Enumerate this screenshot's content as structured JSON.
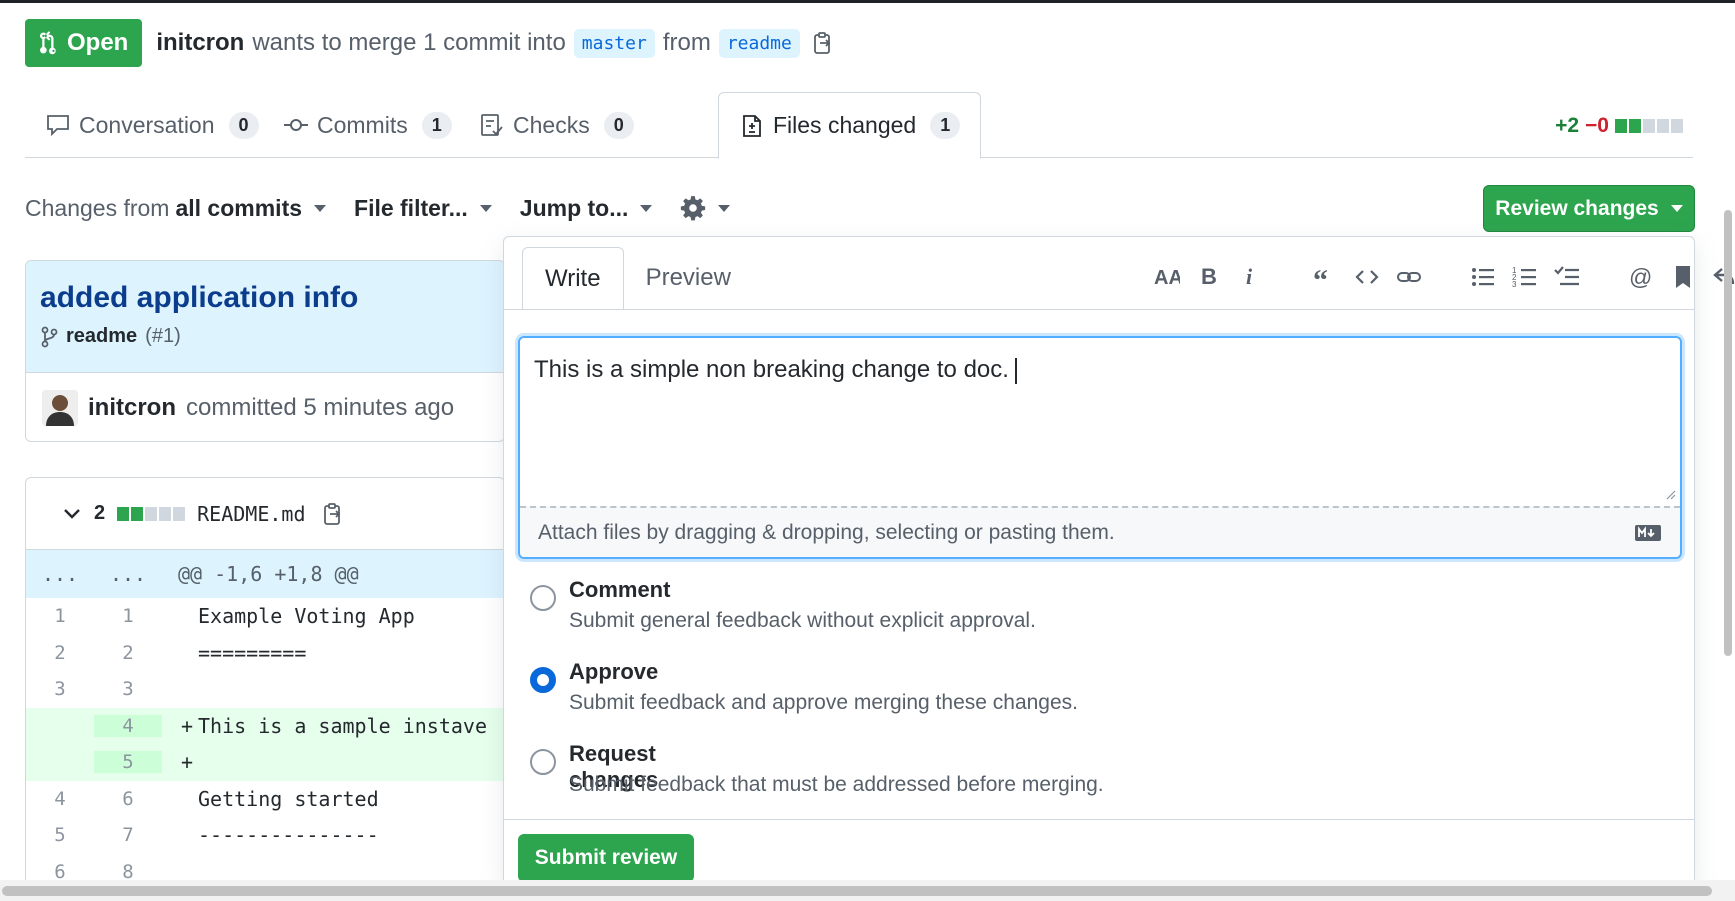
{
  "pr": {
    "status_label": "Open",
    "author": "initcron",
    "merge_text": "wants to merge 1 commit into",
    "base_branch": "master",
    "from_text": "from",
    "head_branch": "readme"
  },
  "tabs": [
    {
      "label": "Conversation",
      "count": "0",
      "icon": "comment-icon"
    },
    {
      "label": "Commits",
      "count": "1",
      "icon": "commit-icon"
    },
    {
      "label": "Checks",
      "count": "0",
      "icon": "checklist-icon"
    },
    {
      "label": "Files changed",
      "count": "1",
      "icon": "file-diff-icon",
      "active": true
    }
  ],
  "diffstat": {
    "additions": "+2",
    "deletions": "−0"
  },
  "toolbar": {
    "changes_prefix": "Changes from",
    "changes_value": "all commits",
    "file_filter": "File filter...",
    "jump_to": "Jump to..."
  },
  "review_button": "Review changes",
  "commit": {
    "title": "added application info",
    "branch": "readme",
    "pr_ref": "(#1)",
    "author": "initcron",
    "time_text": "committed 5 minutes ago"
  },
  "file": {
    "changes": "2",
    "name": "README.md",
    "hunk_left": "...",
    "hunk_right": "...",
    "hunk_header": "@@ -1,6 +1,8 @@",
    "lines": [
      {
        "old": "1",
        "new": "1",
        "sign": "",
        "code": "Example Voting App",
        "type": "context"
      },
      {
        "old": "2",
        "new": "2",
        "sign": "",
        "code": "=========",
        "type": "context"
      },
      {
        "old": "3",
        "new": "3",
        "sign": "",
        "code": "",
        "type": "context"
      },
      {
        "old": "",
        "new": "4",
        "sign": "+",
        "code": "This is a sample instave",
        "type": "added"
      },
      {
        "old": "",
        "new": "5",
        "sign": "+",
        "code": "",
        "type": "added"
      },
      {
        "old": "4",
        "new": "6",
        "sign": "",
        "code": "Getting started",
        "type": "context"
      },
      {
        "old": "5",
        "new": "7",
        "sign": "",
        "code": "---------------",
        "type": "context"
      },
      {
        "old": "6",
        "new": "8",
        "sign": "",
        "code": "",
        "type": "context"
      }
    ]
  },
  "review": {
    "write_tab": "Write",
    "preview_tab": "Preview",
    "comment_text": "This is a simple non breaking change to doc.",
    "attach_text": "Attach files by dragging & dropping, selecting or pasting them.",
    "options": [
      {
        "label": "Comment",
        "desc": "Submit general feedback without explicit approval.",
        "checked": false
      },
      {
        "label": "Approve",
        "desc": "Submit feedback and approve merging these changes.",
        "checked": true
      },
      {
        "label": "Request changes",
        "desc": "Submit feedback that must be addressed before merging.",
        "checked": false
      }
    ],
    "submit_label": "Submit review"
  },
  "colors": {
    "primary_green": "#2da44e",
    "link_blue": "#0969da",
    "deletion_red": "#cf222e"
  }
}
